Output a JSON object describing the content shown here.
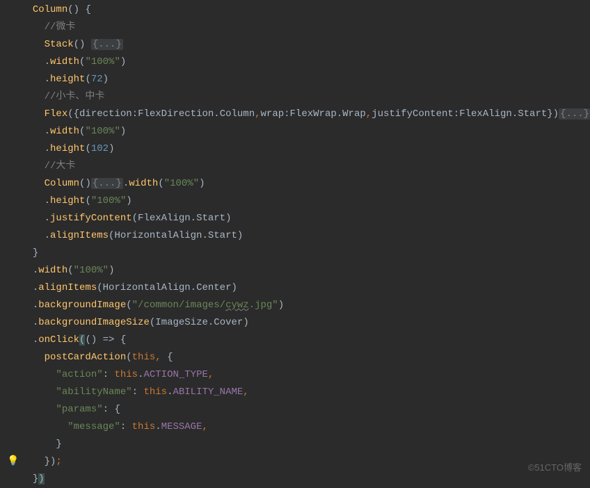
{
  "watermark": "©51CTO博客",
  "bulb_icon": "💡",
  "lines": {
    "l1_column": "Column",
    "l1_brace": "{",
    "l2_comment": "//微卡",
    "l3_stack": "Stack",
    "l3_fold": "{...}",
    "l4_width": "width",
    "l4_val": "\"100%\"",
    "l5_height": "height",
    "l5_val": "72",
    "l6_comment": "//小卡、中卡",
    "l7_flex": "Flex",
    "l7_direction": "direction",
    "l7_flexdir": "FlexDirection",
    "l7_column": "Column",
    "l7_wrap": "wrap",
    "l7_flexwrap": "FlexWrap",
    "l7_wrapval": "Wrap",
    "l7_justify": "justifyContent",
    "l7_flexalign": "FlexAlign",
    "l7_start": "Start",
    "l7_fold": "{...}",
    "l8_width": "width",
    "l8_val": "\"100%\"",
    "l9_height": "height",
    "l9_val": "102",
    "l10_comment": "//大卡",
    "l11_column": "Column",
    "l11_fold": "{...}",
    "l11_width": "width",
    "l11_val": "\"100%\"",
    "l12_height": "height",
    "l12_val": "\"100%\"",
    "l13_justify": "justifyContent",
    "l13_flexalign": "FlexAlign",
    "l13_start": "Start",
    "l14_align": "alignItems",
    "l14_halign": "HorizontalAlign",
    "l14_start": "Start",
    "l16_width": "width",
    "l16_val": "\"100%\"",
    "l17_align": "alignItems",
    "l17_halign": "HorizontalAlign",
    "l17_center": "Center",
    "l18_bgimg": "backgroundImage",
    "l18_val": "\"/common/images/cywz.jpg\"",
    "l18_val_pre": "\"/common/images/",
    "l18_val_wavy": "cywz",
    "l18_val_post": ".jpg\"",
    "l19_bgsize": "backgroundImageSize",
    "l19_imgsize": "ImageSize",
    "l19_cover": "Cover",
    "l20_onclick": "onClick",
    "l21_post": "postCardAction",
    "l21_this": "this",
    "l22_action": "\"action\"",
    "l22_this": "this",
    "l22_type": "ACTION_TYPE",
    "l23_ability": "\"abilityName\"",
    "l23_this": "this",
    "l23_name": "ABILITY_NAME",
    "l24_params": "\"params\"",
    "l25_message": "\"message\"",
    "l25_this": "this",
    "l25_msg": "MESSAGE"
  }
}
